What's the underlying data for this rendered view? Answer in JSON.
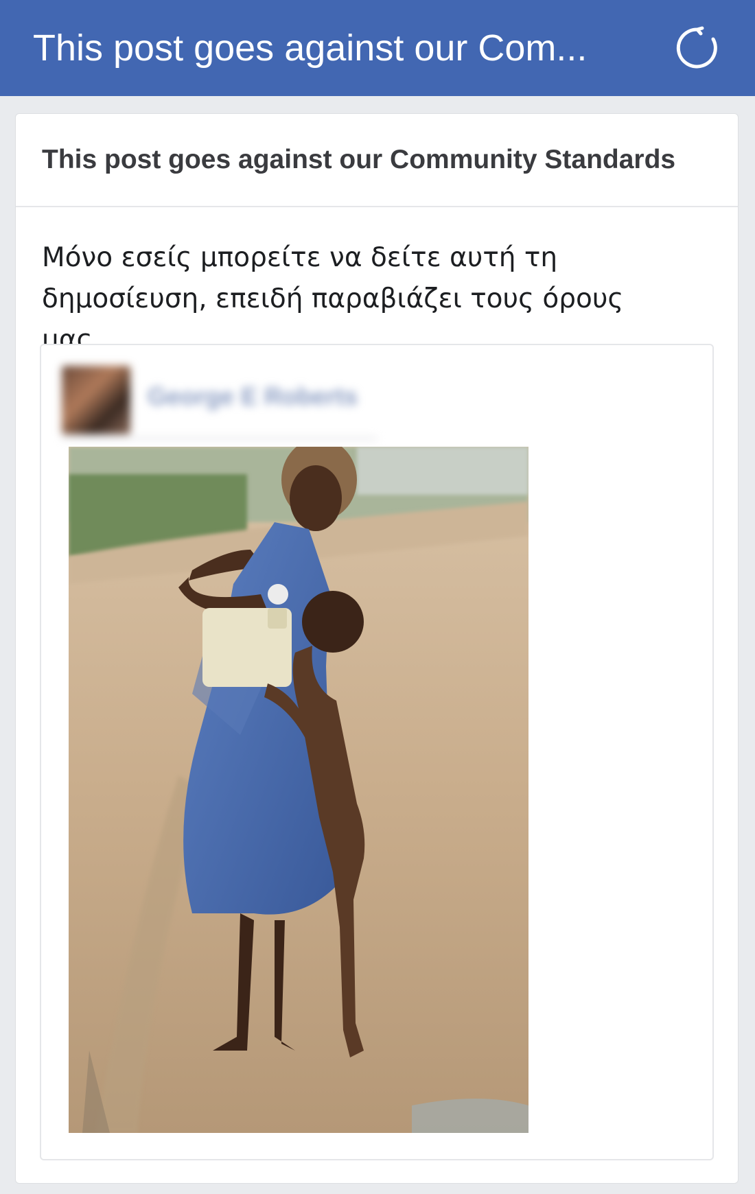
{
  "header": {
    "title": "This post goes against our Com...",
    "refresh_icon": "refresh-icon",
    "background_color": "#4267b2"
  },
  "notice_card": {
    "title": "This post goes against our Community Standards",
    "message": "Μόνο εσείς μπορείτε να δείτε αυτή τη δημοσίευση, επειδή παραβιάζει τους όρους μας."
  },
  "post_preview": {
    "author_name": "George E Roberts",
    "photo_description": "photo"
  }
}
